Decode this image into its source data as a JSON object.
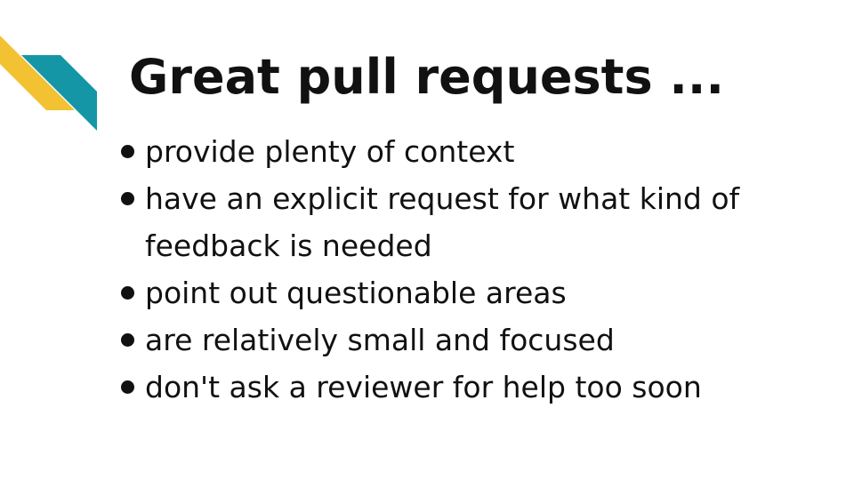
{
  "slide": {
    "title": "Great pull requests ...",
    "bullets": [
      "provide plenty of context",
      "have an explicit request for what kind of feedback is needed",
      "point out questionable areas",
      "are relatively small and focused",
      "don't ask a reviewer for help too soon"
    ]
  },
  "colors": {
    "accent_yellow": "#f2c233",
    "accent_teal": "#1496a6",
    "text": "#111111",
    "background": "#ffffff"
  }
}
